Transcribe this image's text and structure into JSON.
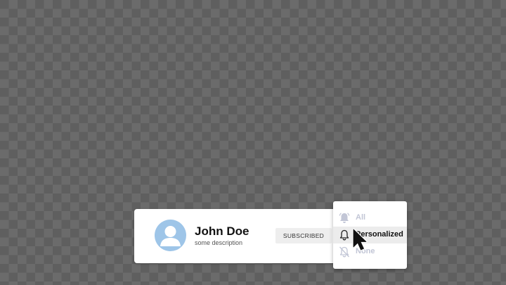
{
  "profile": {
    "name": "John Doe",
    "description": "some description",
    "avatar_icon": "user-avatar-icon"
  },
  "subscribe_button": {
    "label": "SUBSCRIBED"
  },
  "notification_menu": {
    "items": [
      {
        "label": "All",
        "icon": "bell-filled-icon"
      },
      {
        "label": "Personalized",
        "icon": "bell-outline-icon",
        "highlighted": true
      },
      {
        "label": "None",
        "icon": "bell-off-icon"
      }
    ]
  },
  "colors": {
    "avatar_bg": "#9ec5e8",
    "disabled_text": "#c2c6d6",
    "highlight_bg": "#ececec"
  }
}
